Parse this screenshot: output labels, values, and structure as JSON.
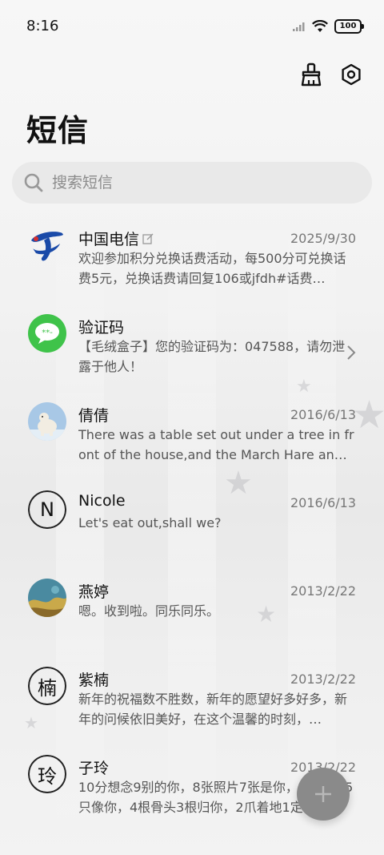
{
  "status_bar": {
    "time": "8:16",
    "battery": "100",
    "icons": [
      "signal-icon",
      "wifi-icon",
      "battery-icon"
    ]
  },
  "header": {
    "title": "短信",
    "actions": [
      {
        "name": "clean-icon"
      },
      {
        "name": "settings-icon"
      }
    ]
  },
  "search": {
    "placeholder": "搜索短信"
  },
  "conversations": [
    {
      "name": "中国电信",
      "date": "2025/9/30",
      "preview": "欢迎参加积分兑换话费活动，每500分可兑换话费5元，兑换话费请回复106或jfdh#话费…",
      "avatar": "china-telecom-logo",
      "has_edit_icon": true
    },
    {
      "name": "验证码",
      "date": "",
      "preview": "【毛绒盒子】您的验证码为：047588，请勿泄露于他人！",
      "avatar": "message-bubble-icon",
      "accent": "#3fc34a"
    },
    {
      "name": "倩倩",
      "date": "2016/6/13",
      "preview": "There was a table set out under a tree in front of the house,and the March Hare an…",
      "avatar": "polar-bear-photo"
    },
    {
      "name": "Nicole",
      "date": "2016/6/13",
      "preview": "Let's eat out,shall we?",
      "avatar_letter": "N"
    },
    {
      "name": "燕婷",
      "date": "2013/2/22",
      "preview": "嗯。收到啦。同乐同乐。",
      "avatar": "landscape-photo"
    },
    {
      "name": "紫楠",
      "date": "2013/2/22",
      "preview": "新年的祝福数不胜数，新年的愿望好多好多，新年的问候依旧美好，在这个温馨的时刻，…",
      "avatar_letter": "楠"
    },
    {
      "name": "子玲",
      "date": "2013/2/22",
      "preview": "10分想念9别的你，8张照片7张是你，6只小狗5只像你，4根骨头3根归你，2爪着地1定…",
      "avatar_letter": "玲"
    }
  ],
  "fab": {
    "icon": "plus-icon",
    "color": "#8a8a8a"
  }
}
